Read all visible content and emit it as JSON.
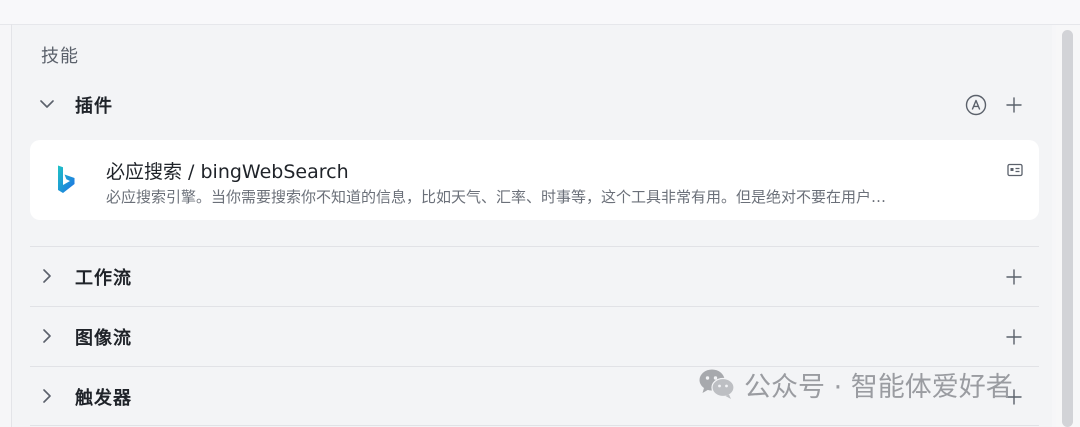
{
  "section": {
    "title": "技能"
  },
  "groups": {
    "plugins": {
      "label": "插件",
      "expanded": true,
      "auto_icon": "circled-a-icon",
      "add_icon": "plus-icon"
    },
    "workflow": {
      "label": "工作流",
      "expanded": false,
      "add_icon": "plus-icon"
    },
    "imageflow": {
      "label": "图像流",
      "expanded": false,
      "add_icon": "plus-icon"
    },
    "trigger": {
      "label": "触发器",
      "expanded": false,
      "add_icon": "plus-icon"
    }
  },
  "plugin_card": {
    "name": "必应搜索 / bingWebSearch",
    "description": "必应搜索引擎。当你需要搜索你不知道的信息，比如天气、汇率、时事等，这个工具非常有用。但是绝对不要在用户…",
    "logo": "bing-logo",
    "action_icon": "card-details-icon"
  },
  "watermark": {
    "text": "公众号 · 智能体爱好者",
    "icon": "wechat-icon"
  },
  "colors": {
    "panel_bg": "#f3f4f6",
    "card_bg": "#ffffff",
    "text_primary": "#1f2329",
    "text_secondary": "#6b7079",
    "bing_blue": "#1e88e5",
    "bing_teal": "#1fc3c5"
  }
}
